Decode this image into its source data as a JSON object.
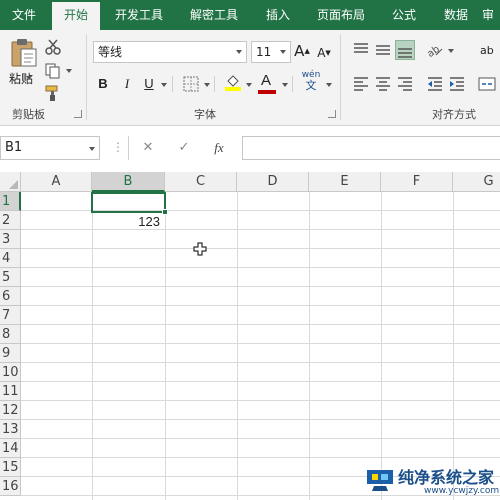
{
  "ribbon": {
    "tabs": [
      "文件",
      "开始",
      "开发工具",
      "解密工具",
      "插入",
      "页面布局",
      "公式",
      "数据",
      "审"
    ],
    "active_tab": "开始",
    "paste_label": "粘贴",
    "clipboard_group": "剪贴板",
    "font_group": "字体",
    "align_group": "对齐方式",
    "font_name": "等线",
    "font_size": "11",
    "bold": "B",
    "italic": "I",
    "underline": "U",
    "font_color_glyph": "A",
    "grow_font": "A",
    "shrink_font": "A",
    "phonetic": "wén",
    "phonetic_sub": "文",
    "wrap_text": "ab",
    "accent_color": "#217346",
    "highlight_color": "#ffff00",
    "font_color": "#c00000"
  },
  "formula_bar": {
    "name_box": "B1",
    "cancel_glyph": "✕",
    "enter_glyph": "✓",
    "fx_glyph": "fx",
    "formula": ""
  },
  "sheet": {
    "columns": [
      "A",
      "B",
      "C",
      "D",
      "E",
      "F",
      "G"
    ],
    "selected_column": "B",
    "rows": [
      "1",
      "2",
      "3",
      "4",
      "5",
      "6",
      "7",
      "8",
      "9",
      "10",
      "11",
      "12",
      "13",
      "14",
      "15",
      "16"
    ],
    "selected_row": "1",
    "active_cell": "B1",
    "cell_b2": "123"
  },
  "watermark": {
    "title": "纯净系统之家",
    "url": "www.ycwjzy.com"
  }
}
